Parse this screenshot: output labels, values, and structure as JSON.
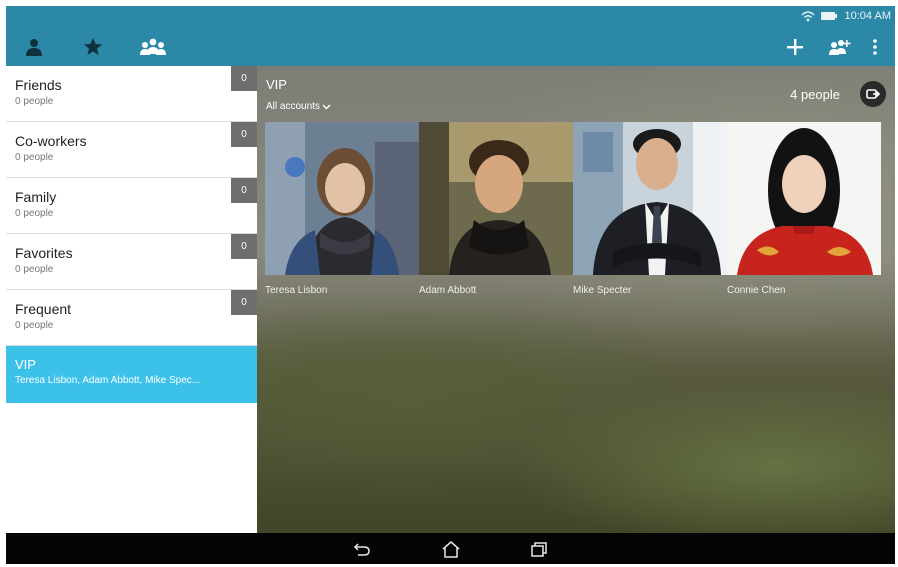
{
  "status_bar": {
    "time": "10:04 AM",
    "icons": [
      "wifi-icon",
      "battery-icon"
    ]
  },
  "action_bar": {
    "left_tabs": [
      "person-icon",
      "star-icon",
      "groups-icon"
    ],
    "right_actions": [
      "add-icon",
      "add-group-icon",
      "overflow-menu-icon"
    ]
  },
  "groups": [
    {
      "name": "Friends",
      "subtitle": "0 people",
      "count": "0"
    },
    {
      "name": "Co-workers",
      "subtitle": "0 people",
      "count": "0"
    },
    {
      "name": "Family",
      "subtitle": "0 people",
      "count": "0"
    },
    {
      "name": "Favorites",
      "subtitle": "0 people",
      "count": "0"
    },
    {
      "name": "Frequent",
      "subtitle": "0 people",
      "count": "0"
    },
    {
      "name": "VIP",
      "subtitle": "Teresa Lisbon, Adam Abbott, Mike Spec...",
      "selected": true
    }
  ],
  "detail": {
    "title": "VIP",
    "accounts_label": "All accounts",
    "people_count": "4 people",
    "members": [
      {
        "name": "Teresa Lisbon"
      },
      {
        "name": "Adam Abbott"
      },
      {
        "name": "Mike Specter"
      },
      {
        "name": "Connie Chen"
      }
    ]
  },
  "colors": {
    "accent": "#2b88a7",
    "selected": "#3cc1e8",
    "count_badge": "#6e6e6e"
  }
}
